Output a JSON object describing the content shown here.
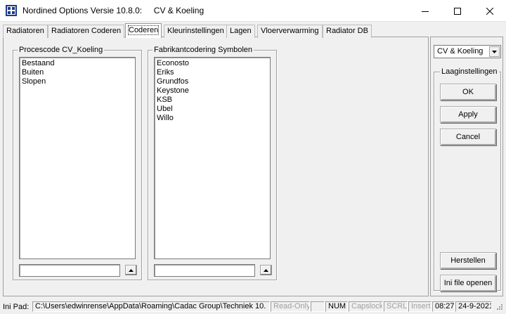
{
  "window": {
    "title": "Nordined Options Versie 10.8.0:     CV & Koeling",
    "minimize_icon": "minimize-icon",
    "maximize_icon": "maximize-icon",
    "close_icon": "close-icon"
  },
  "tabs": [
    {
      "label": "Radiatoren"
    },
    {
      "label": "Radiatoren Coderen"
    },
    {
      "label": "Coderen",
      "active": true
    },
    {
      "label": "Kleurinstellingen"
    },
    {
      "label": "Lagen"
    },
    {
      "label": "Vloerverwarming"
    },
    {
      "label": "Radiator DB"
    }
  ],
  "process_group": {
    "legend": "Procescode CV_Koeling",
    "items": [
      "Bestaand",
      "Buiten",
      "Slopen"
    ],
    "input_value": ""
  },
  "manufacturer_group": {
    "legend": "Fabrikantcodering Symbolen",
    "items": [
      "Econosto",
      "Eriks",
      "Grundfos",
      "Keystone",
      "KSB",
      "Ubel",
      "Willo"
    ],
    "input_value": ""
  },
  "right_panel": {
    "layer_select_value": "CV & Koeling",
    "layer_settings_legend": "Laaginstellingen",
    "ok_label": "OK",
    "apply_label": "Apply",
    "cancel_label": "Cancel",
    "restore_label": "Herstellen",
    "ini_open_label": "Ini file openen"
  },
  "statusbar": {
    "ini_label": "Ini Pad:",
    "ini_path": "C:\\Users\\edwinrense\\AppData\\Roaming\\Cadac Group\\Techniek 10.",
    "read_only": "Read-Only",
    "blank": "",
    "num": "NUM",
    "capslock": "Capslock",
    "scrl": "SCRL",
    "insert": "Insert",
    "time": "08:27",
    "date": "24-9-2021"
  },
  "colors": {
    "window_bg": "#f0f0f0",
    "title_bg": "#ffffff",
    "disabled_text": "#a0a0a0"
  }
}
